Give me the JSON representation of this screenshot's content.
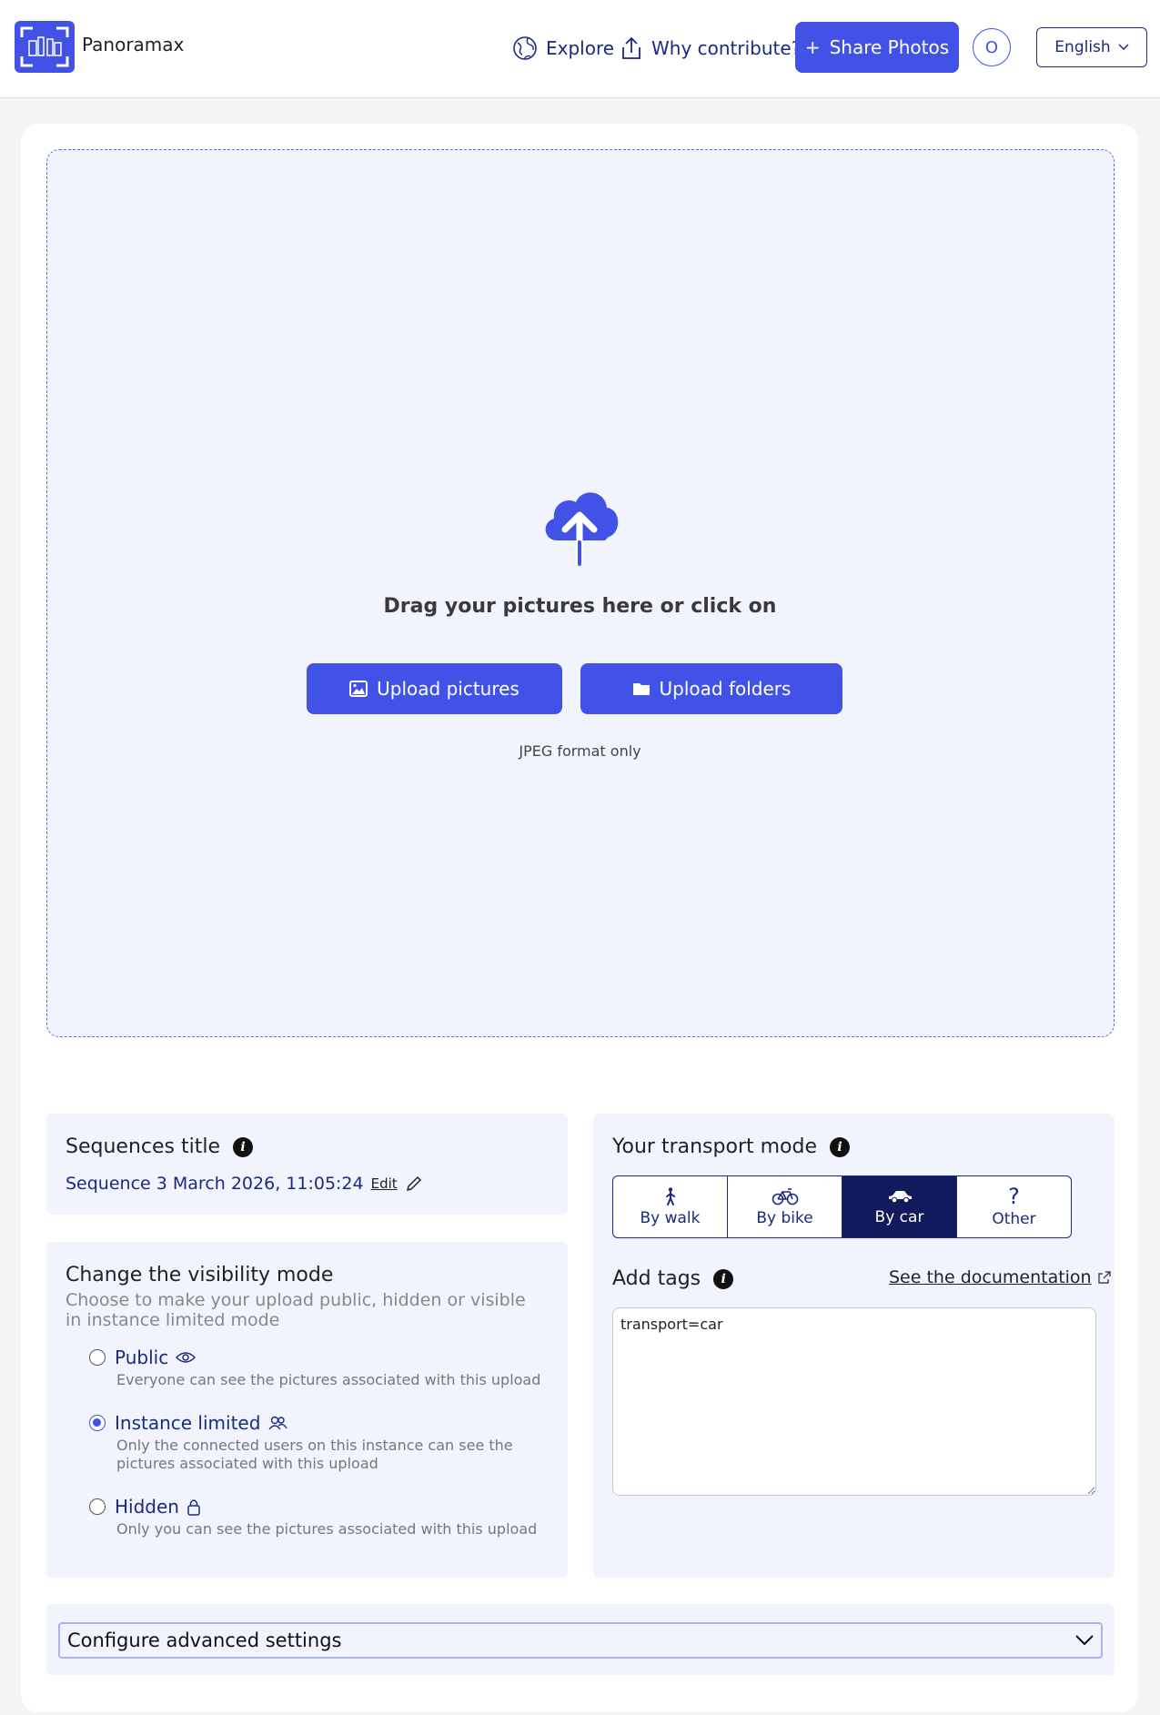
{
  "header": {
    "brand": "Panoramax",
    "nav": {
      "explore": "Explore",
      "why": "Why contribute?"
    },
    "share_label": "Share Photos",
    "share_plus": "+",
    "avatar_initial": "O",
    "language": "English"
  },
  "upload": {
    "title": "Drag your pictures here or click on",
    "upload_pictures": "Upload pictures",
    "upload_folders": "Upload folders",
    "format_note": "JPEG format only"
  },
  "sequence": {
    "title": "Sequences title",
    "value": "Sequence 3 March 2026, 11:05:24",
    "edit_label": "Edit"
  },
  "visibility": {
    "title": "Change the visibility mode",
    "subtitle": "Choose to make your upload public, hidden or visible in instance limited mode",
    "options": [
      {
        "label": "Public",
        "desc": "Everyone can see the pictures associated with this upload",
        "checked": false
      },
      {
        "label": "Instance limited",
        "desc": "Only the connected users on this instance can see the pictures associated with this upload",
        "checked": true
      },
      {
        "label": "Hidden",
        "desc": "Only you can see the pictures associated with this upload",
        "checked": false
      }
    ]
  },
  "transport": {
    "title": "Your transport mode",
    "options": [
      "By walk",
      "By bike",
      "By car",
      "Other"
    ],
    "selected": "By car"
  },
  "tags": {
    "title": "Add tags",
    "doc_link": "See the documentation",
    "value": "transport=car"
  },
  "advanced": {
    "label": "Configure advanced settings"
  },
  "colors": {
    "accent": "#4252e6",
    "navy": "#1a2a80",
    "selected": "#101a5c",
    "panel": "#f2f4fd"
  }
}
